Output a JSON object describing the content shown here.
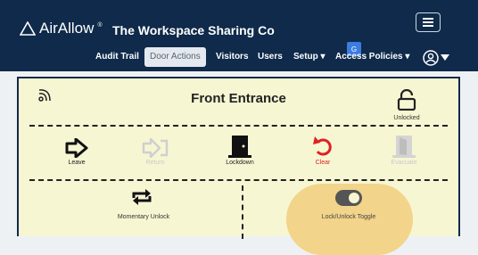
{
  "header": {
    "logo_text": "AirAllow",
    "company": "The Workspace Sharing Co"
  },
  "nav": {
    "items": [
      "Audit Trail",
      "Door Actions",
      "Visitors",
      "Users",
      "Setup",
      "Access Policies"
    ]
  },
  "door": {
    "name": "Front Entrance",
    "status": "Unlocked",
    "actions": [
      "Leave",
      "Return",
      "Lockdown",
      "Clear",
      "Evacuate"
    ],
    "momentary_label": "Momentary Unlock",
    "toggle_label": "Lock/Unlock Toggle"
  },
  "colors": {
    "header_bg": "#0f2a4a",
    "panel_bg": "#f7f6d3",
    "clear_red": "#e02020",
    "toggle_highlight": "#f2d48a"
  }
}
